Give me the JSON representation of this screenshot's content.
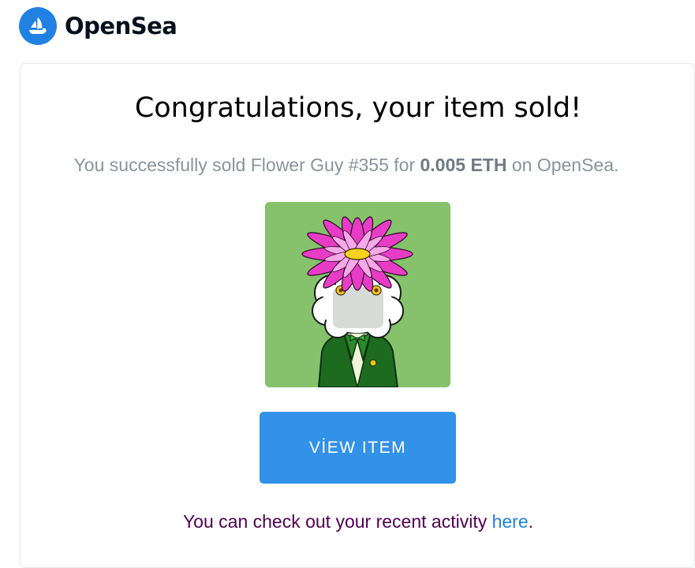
{
  "brand": {
    "name": "OpenSea",
    "logo_icon": "opensea-sailboat-icon",
    "accent_color": "#2081e2"
  },
  "email": {
    "title": "Congratulations, your item sold!",
    "subtitle_prefix": "You successfully sold Flower Guy #355 for",
    "price": "0.005 ETH",
    "subtitle_suffix": "on OpenSea.",
    "nft_image": "flower-guy-nft-image",
    "button_label": "VİEW ITEM",
    "button_color": "#3291e9",
    "activity_text": "You can check out your recent activity",
    "activity_link": "here",
    "activity_end": "."
  }
}
